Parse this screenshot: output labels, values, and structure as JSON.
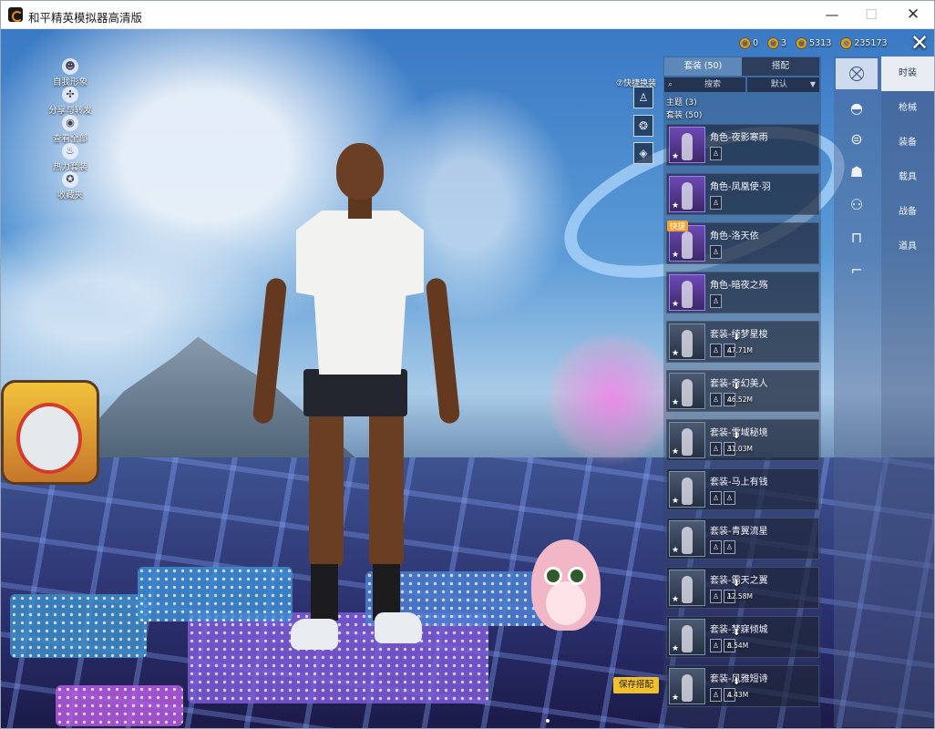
{
  "window": {
    "title": "和平精英模拟器高清版",
    "minimize": "—",
    "maximize": "☐",
    "close": "✕"
  },
  "left_menu": [
    {
      "icon": "person-icon",
      "glyph": "☻",
      "label": "自我形象"
    },
    {
      "icon": "share-icon",
      "glyph": "✣",
      "label": "分享与转发"
    },
    {
      "icon": "eye-icon",
      "glyph": "◉",
      "label": "查看全部"
    },
    {
      "icon": "fire-icon",
      "glyph": "♨",
      "label": "热力套装"
    },
    {
      "icon": "badge-icon",
      "glyph": "✪",
      "label": "收藏夹"
    }
  ],
  "currency": [
    {
      "icon": "coin-icon",
      "value": "0"
    },
    {
      "icon": "token-icon",
      "value": "3"
    },
    {
      "icon": "gold-icon",
      "value": "5313"
    },
    {
      "icon": "diamond-icon",
      "value": "235173"
    }
  ],
  "quick_switch": {
    "label": "⑦快捷换装",
    "slots": [
      "♙",
      "❂",
      "◈"
    ]
  },
  "panel": {
    "tabs": [
      {
        "label": "套装 (50)",
        "active": true
      },
      {
        "label": "搭配",
        "active": false
      }
    ],
    "search_label": "搜索",
    "sort_label": "默认",
    "theme_header": "主题 (3)",
    "set_header": "套装 (50)",
    "items": [
      {
        "name": "角色-夜影寒雨",
        "thumb": "purple",
        "downloadable": false,
        "size": ""
      },
      {
        "name": "角色-凤凰使·羽",
        "thumb": "purple",
        "downloadable": false,
        "size": ""
      },
      {
        "name": "角色-洛天依",
        "thumb": "purple",
        "downloadable": false,
        "size": "",
        "badge": "快捷"
      },
      {
        "name": "角色-暗夜之殇",
        "thumb": "purple",
        "downloadable": false,
        "size": ""
      },
      {
        "name": "套装-绮梦星梭",
        "thumb": "grey",
        "downloadable": true,
        "size": "47.71M"
      },
      {
        "name": "套装-奇幻美人",
        "thumb": "grey",
        "downloadable": true,
        "size": "46.52M"
      },
      {
        "name": "套装-雪域秘境",
        "thumb": "grey",
        "downloadable": true,
        "size": "31.03M"
      },
      {
        "name": "套装-马上有钱",
        "thumb": "grey",
        "downloadable": false,
        "size": ""
      },
      {
        "name": "套装-青翼流星",
        "thumb": "grey",
        "downloadable": false,
        "size": ""
      },
      {
        "name": "套装-霸天之翼",
        "thumb": "grey",
        "downloadable": true,
        "size": "12.58M"
      },
      {
        "name": "套装-梦寐倾城",
        "thumb": "grey",
        "downloadable": true,
        "size": "8.54M"
      },
      {
        "name": "套装-风雅短诗",
        "thumb": "grey",
        "downloadable": true,
        "size": "4.43M"
      }
    ],
    "save_button": "保存搭配"
  },
  "rail_icons": [
    "hanger-icon",
    "helmet-icon",
    "goggles-icon",
    "mask-icon",
    "jacket-icon",
    "pants-icon",
    "boot-icon"
  ],
  "categories": [
    {
      "label": "时装",
      "active": true
    },
    {
      "label": "枪械",
      "active": false
    },
    {
      "label": "装备",
      "active": false
    },
    {
      "label": "载具",
      "active": false
    },
    {
      "label": "战备",
      "active": false
    },
    {
      "label": "道具",
      "active": false
    }
  ],
  "colors": {
    "accent": "#f2c12a",
    "active_tab": "#5d88b8",
    "rare_border": "#a279ff"
  }
}
